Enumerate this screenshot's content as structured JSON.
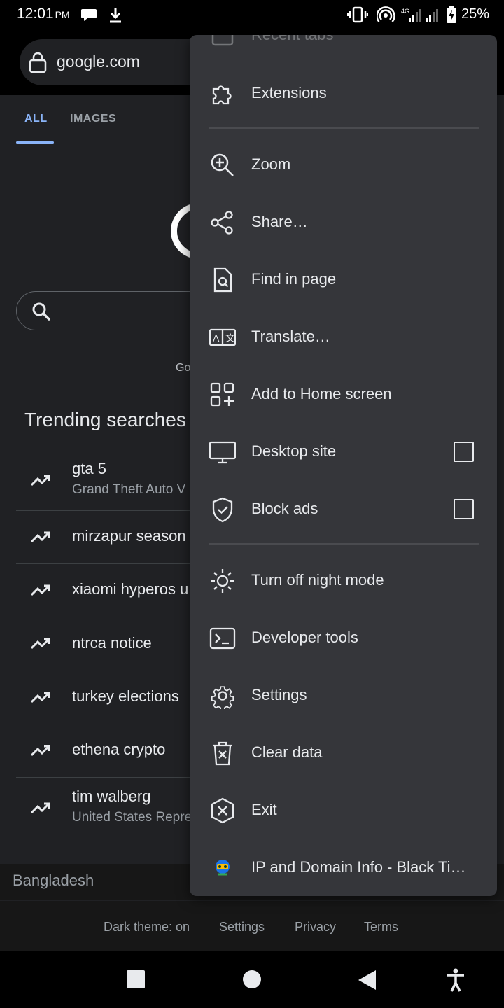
{
  "status_bar": {
    "time": "12:01",
    "ampm": "PM",
    "battery": "25%"
  },
  "url_bar": {
    "url": "google.com"
  },
  "tabs": [
    {
      "label": "ALL",
      "selected": true
    },
    {
      "label": "IMAGES",
      "selected": false
    }
  ],
  "page": {
    "footer_partial_text": "Go",
    "trending_title": "Trending searches",
    "trending": [
      {
        "title": "gta 5",
        "subtitle": "Grand Theft Auto V"
      },
      {
        "title": "mirzapur season"
      },
      {
        "title": "xiaomi hyperos u"
      },
      {
        "title": "ntrca notice"
      },
      {
        "title": "turkey elections"
      },
      {
        "title": "ethena crypto"
      },
      {
        "title": "tim walberg",
        "subtitle": "United States Repre"
      }
    ],
    "region": "Bangladesh",
    "footer_links": {
      "dark_theme": "Dark theme: on",
      "settings": "Settings",
      "privacy": "Privacy",
      "terms": "Terms"
    }
  },
  "menu": {
    "items": [
      {
        "label": "Recent tabs",
        "icon": "recent-tabs-icon"
      },
      {
        "label": "Extensions",
        "icon": "puzzle-icon"
      },
      {
        "label": "Zoom",
        "icon": "zoom-in-icon"
      },
      {
        "label": "Share…",
        "icon": "share-icon"
      },
      {
        "label": "Find in page",
        "icon": "find-in-page-icon"
      },
      {
        "label": "Translate…",
        "icon": "translate-icon"
      },
      {
        "label": "Add to Home screen",
        "icon": "add-to-home-icon"
      },
      {
        "label": "Desktop site",
        "icon": "desktop-icon",
        "checked": false
      },
      {
        "label": "Block ads",
        "icon": "shield-check-icon",
        "checked": false
      },
      {
        "label": "Turn off night mode",
        "icon": "sun-icon"
      },
      {
        "label": "Developer tools",
        "icon": "terminal-icon"
      },
      {
        "label": "Settings",
        "icon": "gear-icon"
      },
      {
        "label": "Clear data",
        "icon": "trash-icon"
      },
      {
        "label": "Exit",
        "icon": "close-circle-icon"
      },
      {
        "label": "IP and Domain Info - Black Ti…",
        "icon": "extension-logo-icon"
      }
    ]
  },
  "colors": {
    "accent": "#8ab4f8",
    "menu_bg": "#35363a",
    "page_bg": "#202124"
  }
}
